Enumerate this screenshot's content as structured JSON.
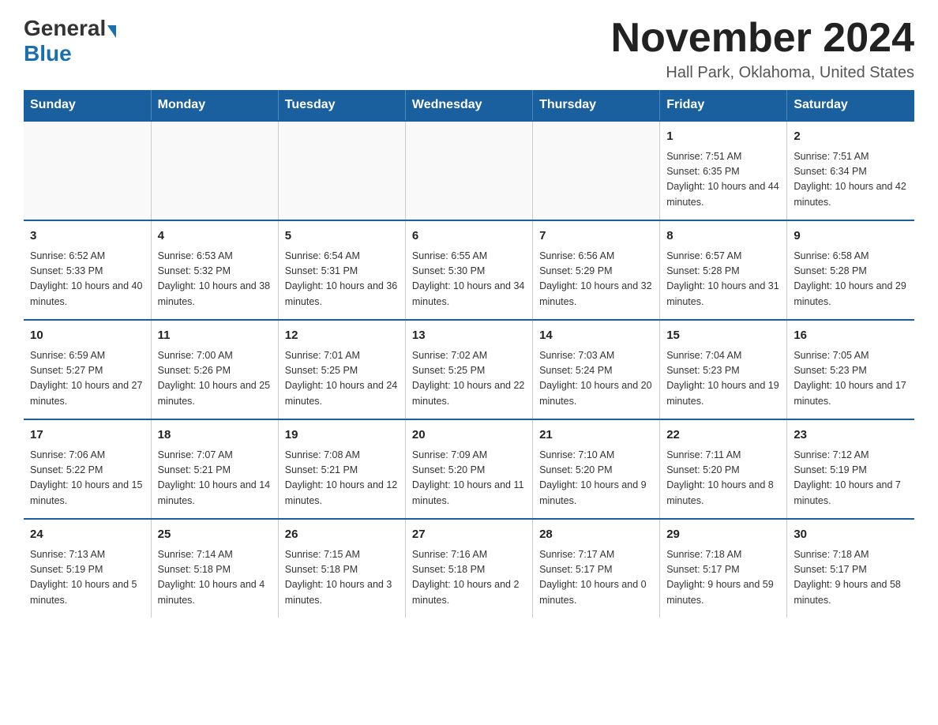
{
  "header": {
    "logo_general": "General",
    "logo_blue": "Blue",
    "month_title": "November 2024",
    "location": "Hall Park, Oklahoma, United States"
  },
  "calendar": {
    "days_of_week": [
      "Sunday",
      "Monday",
      "Tuesday",
      "Wednesday",
      "Thursday",
      "Friday",
      "Saturday"
    ],
    "weeks": [
      [
        {
          "day": "",
          "sunrise": "",
          "sunset": "",
          "daylight": ""
        },
        {
          "day": "",
          "sunrise": "",
          "sunset": "",
          "daylight": ""
        },
        {
          "day": "",
          "sunrise": "",
          "sunset": "",
          "daylight": ""
        },
        {
          "day": "",
          "sunrise": "",
          "sunset": "",
          "daylight": ""
        },
        {
          "day": "",
          "sunrise": "",
          "sunset": "",
          "daylight": ""
        },
        {
          "day": "1",
          "sunrise": "Sunrise: 7:51 AM",
          "sunset": "Sunset: 6:35 PM",
          "daylight": "Daylight: 10 hours and 44 minutes."
        },
        {
          "day": "2",
          "sunrise": "Sunrise: 7:51 AM",
          "sunset": "Sunset: 6:34 PM",
          "daylight": "Daylight: 10 hours and 42 minutes."
        }
      ],
      [
        {
          "day": "3",
          "sunrise": "Sunrise: 6:52 AM",
          "sunset": "Sunset: 5:33 PM",
          "daylight": "Daylight: 10 hours and 40 minutes."
        },
        {
          "day": "4",
          "sunrise": "Sunrise: 6:53 AM",
          "sunset": "Sunset: 5:32 PM",
          "daylight": "Daylight: 10 hours and 38 minutes."
        },
        {
          "day": "5",
          "sunrise": "Sunrise: 6:54 AM",
          "sunset": "Sunset: 5:31 PM",
          "daylight": "Daylight: 10 hours and 36 minutes."
        },
        {
          "day": "6",
          "sunrise": "Sunrise: 6:55 AM",
          "sunset": "Sunset: 5:30 PM",
          "daylight": "Daylight: 10 hours and 34 minutes."
        },
        {
          "day": "7",
          "sunrise": "Sunrise: 6:56 AM",
          "sunset": "Sunset: 5:29 PM",
          "daylight": "Daylight: 10 hours and 32 minutes."
        },
        {
          "day": "8",
          "sunrise": "Sunrise: 6:57 AM",
          "sunset": "Sunset: 5:28 PM",
          "daylight": "Daylight: 10 hours and 31 minutes."
        },
        {
          "day": "9",
          "sunrise": "Sunrise: 6:58 AM",
          "sunset": "Sunset: 5:28 PM",
          "daylight": "Daylight: 10 hours and 29 minutes."
        }
      ],
      [
        {
          "day": "10",
          "sunrise": "Sunrise: 6:59 AM",
          "sunset": "Sunset: 5:27 PM",
          "daylight": "Daylight: 10 hours and 27 minutes."
        },
        {
          "day": "11",
          "sunrise": "Sunrise: 7:00 AM",
          "sunset": "Sunset: 5:26 PM",
          "daylight": "Daylight: 10 hours and 25 minutes."
        },
        {
          "day": "12",
          "sunrise": "Sunrise: 7:01 AM",
          "sunset": "Sunset: 5:25 PM",
          "daylight": "Daylight: 10 hours and 24 minutes."
        },
        {
          "day": "13",
          "sunrise": "Sunrise: 7:02 AM",
          "sunset": "Sunset: 5:25 PM",
          "daylight": "Daylight: 10 hours and 22 minutes."
        },
        {
          "day": "14",
          "sunrise": "Sunrise: 7:03 AM",
          "sunset": "Sunset: 5:24 PM",
          "daylight": "Daylight: 10 hours and 20 minutes."
        },
        {
          "day": "15",
          "sunrise": "Sunrise: 7:04 AM",
          "sunset": "Sunset: 5:23 PM",
          "daylight": "Daylight: 10 hours and 19 minutes."
        },
        {
          "day": "16",
          "sunrise": "Sunrise: 7:05 AM",
          "sunset": "Sunset: 5:23 PM",
          "daylight": "Daylight: 10 hours and 17 minutes."
        }
      ],
      [
        {
          "day": "17",
          "sunrise": "Sunrise: 7:06 AM",
          "sunset": "Sunset: 5:22 PM",
          "daylight": "Daylight: 10 hours and 15 minutes."
        },
        {
          "day": "18",
          "sunrise": "Sunrise: 7:07 AM",
          "sunset": "Sunset: 5:21 PM",
          "daylight": "Daylight: 10 hours and 14 minutes."
        },
        {
          "day": "19",
          "sunrise": "Sunrise: 7:08 AM",
          "sunset": "Sunset: 5:21 PM",
          "daylight": "Daylight: 10 hours and 12 minutes."
        },
        {
          "day": "20",
          "sunrise": "Sunrise: 7:09 AM",
          "sunset": "Sunset: 5:20 PM",
          "daylight": "Daylight: 10 hours and 11 minutes."
        },
        {
          "day": "21",
          "sunrise": "Sunrise: 7:10 AM",
          "sunset": "Sunset: 5:20 PM",
          "daylight": "Daylight: 10 hours and 9 minutes."
        },
        {
          "day": "22",
          "sunrise": "Sunrise: 7:11 AM",
          "sunset": "Sunset: 5:20 PM",
          "daylight": "Daylight: 10 hours and 8 minutes."
        },
        {
          "day": "23",
          "sunrise": "Sunrise: 7:12 AM",
          "sunset": "Sunset: 5:19 PM",
          "daylight": "Daylight: 10 hours and 7 minutes."
        }
      ],
      [
        {
          "day": "24",
          "sunrise": "Sunrise: 7:13 AM",
          "sunset": "Sunset: 5:19 PM",
          "daylight": "Daylight: 10 hours and 5 minutes."
        },
        {
          "day": "25",
          "sunrise": "Sunrise: 7:14 AM",
          "sunset": "Sunset: 5:18 PM",
          "daylight": "Daylight: 10 hours and 4 minutes."
        },
        {
          "day": "26",
          "sunrise": "Sunrise: 7:15 AM",
          "sunset": "Sunset: 5:18 PM",
          "daylight": "Daylight: 10 hours and 3 minutes."
        },
        {
          "day": "27",
          "sunrise": "Sunrise: 7:16 AM",
          "sunset": "Sunset: 5:18 PM",
          "daylight": "Daylight: 10 hours and 2 minutes."
        },
        {
          "day": "28",
          "sunrise": "Sunrise: 7:17 AM",
          "sunset": "Sunset: 5:17 PM",
          "daylight": "Daylight: 10 hours and 0 minutes."
        },
        {
          "day": "29",
          "sunrise": "Sunrise: 7:18 AM",
          "sunset": "Sunset: 5:17 PM",
          "daylight": "Daylight: 9 hours and 59 minutes."
        },
        {
          "day": "30",
          "sunrise": "Sunrise: 7:18 AM",
          "sunset": "Sunset: 5:17 PM",
          "daylight": "Daylight: 9 hours and 58 minutes."
        }
      ]
    ]
  }
}
